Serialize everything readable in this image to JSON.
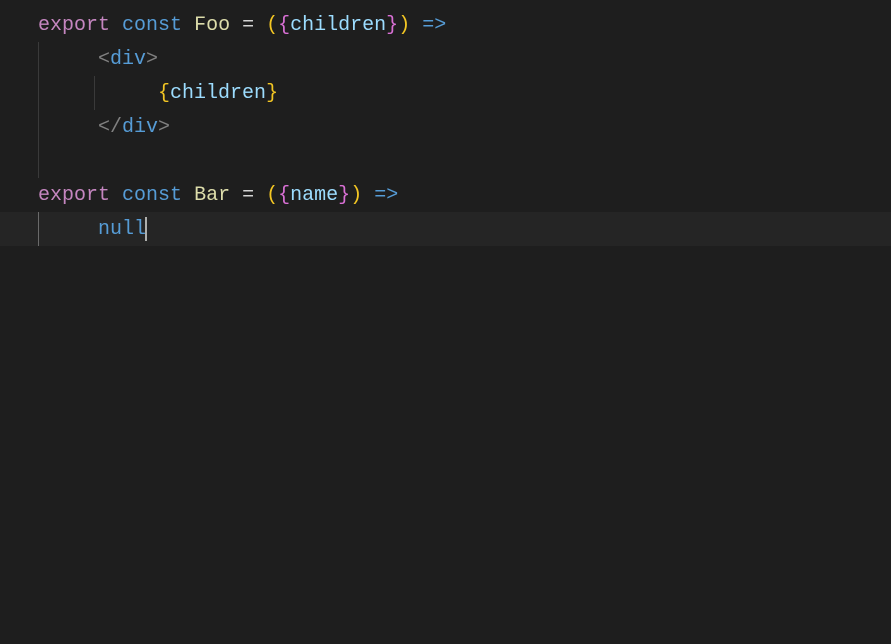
{
  "editor": {
    "cursor_line": 7,
    "tokens": {
      "export": "export",
      "const": "const",
      "foo": "Foo",
      "bar": "Bar",
      "eq": "=",
      "arrow": "=>",
      "children": "children",
      "name": "name",
      "div": "div",
      "null": "null",
      "lparen": "(",
      "rparen": ")",
      "lbrace": "{",
      "rbrace": "}",
      "lt": "<",
      "gt": ">",
      "ltslash": "</"
    }
  }
}
